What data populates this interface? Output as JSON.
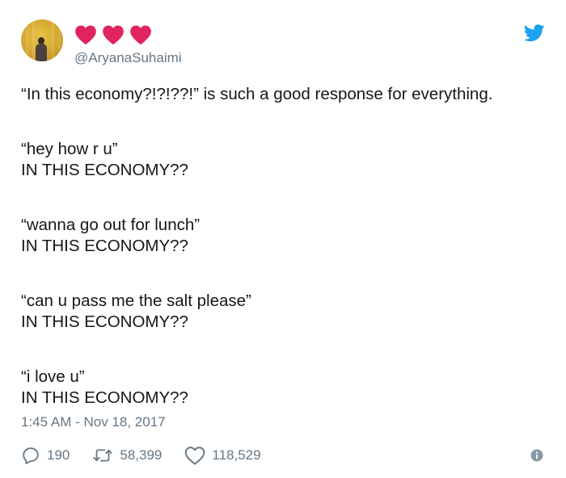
{
  "tweet": {
    "display_name_icons": [
      "heart-emoji",
      "heart-emoji",
      "heart-emoji"
    ],
    "handle": "@AryanaSuhaimi",
    "text_lines": [
      "“In this economy?!?!??!” is such a good response for everything.",
      "“hey how r u”",
      "IN THIS ECONOMY??",
      "“wanna go out for lunch”",
      "IN THIS ECONOMY??",
      "“can u pass me the salt please”",
      "IN THIS ECONOMY??",
      "“i love u”",
      "IN THIS ECONOMY??"
    ],
    "timestamp": "1:45 AM - Nov 18, 2017",
    "replies": "190",
    "retweets": "58,399",
    "likes": "118,529"
  },
  "colors": {
    "heart": "#e0245e",
    "twitter_blue": "#1da1f2",
    "secondary_text": "#657786",
    "primary_text": "#14171a"
  },
  "icons": {
    "brand": "twitter-bird-icon",
    "reply": "reply-icon",
    "retweet": "retweet-icon",
    "like": "like-icon",
    "info": "info-icon"
  }
}
